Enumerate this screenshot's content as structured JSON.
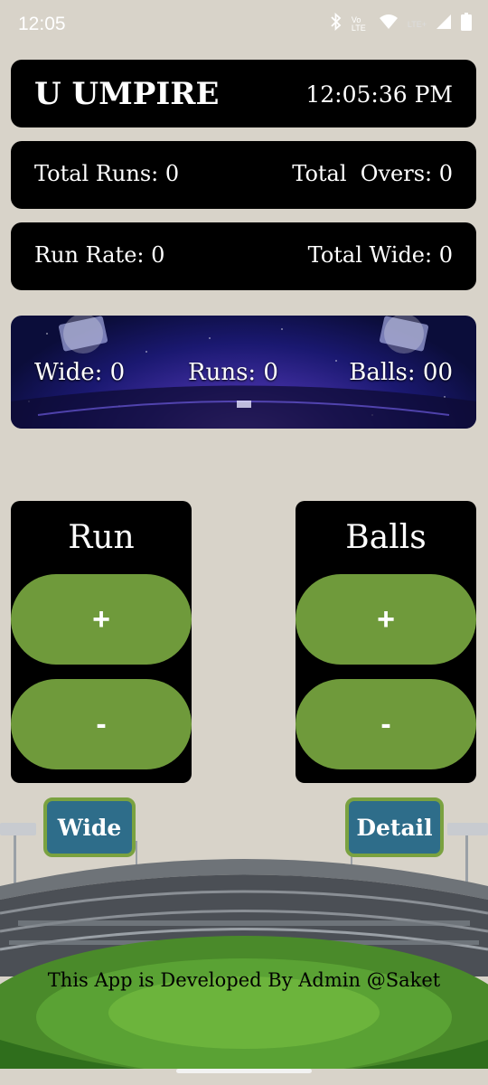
{
  "status_bar": {
    "time": "12:05",
    "network_label": "Vo LTE",
    "lte_label": "LTE+"
  },
  "header": {
    "title": "U UMPIRE",
    "clock": "12:05:36 PM"
  },
  "stats": {
    "total_runs": "Total Runs: 0",
    "total_overs": "Total  Overs: 0",
    "run_rate": "Run Rate: 0",
    "total_wide": "Total Wide: 0"
  },
  "scoreboard": {
    "wide": "Wide: 0",
    "runs": "Runs: 0",
    "balls": "Balls: 00"
  },
  "run_panel": {
    "title": "Run",
    "plus": "+",
    "minus": "-"
  },
  "balls_panel": {
    "title": "Balls",
    "plus": "+",
    "minus": "-"
  },
  "actions": {
    "wide": "Wide",
    "detail": "Detail"
  },
  "footer": {
    "text": "This App is Developed By Admin @Saket"
  },
  "colors": {
    "background": "#d8d3c9",
    "card": "#000000",
    "counter_button": "#6f9a3b",
    "action_button": "#2e6d8a",
    "action_border": "#7aa240"
  },
  "icons": [
    "bluetooth-icon",
    "wifi-icon",
    "signal-icon",
    "battery-icon"
  ]
}
